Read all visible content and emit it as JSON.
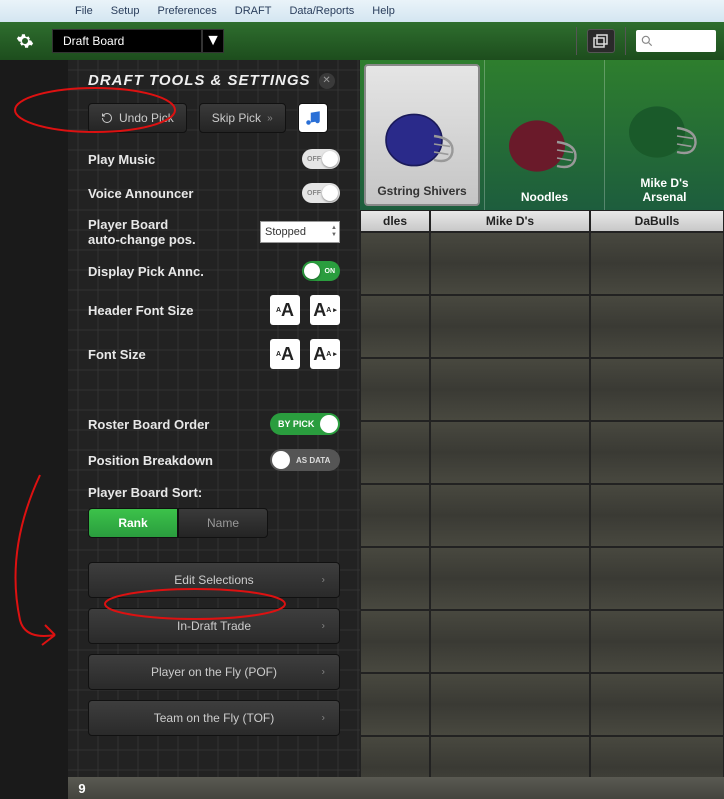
{
  "menu": {
    "file": "File",
    "setup": "Setup",
    "preferences": "Preferences",
    "draft": "DRAFT",
    "data_reports": "Data/Reports",
    "help": "Help"
  },
  "toolbar": {
    "draft_board": "Draft Board"
  },
  "panel": {
    "title": "DRAFT TOOLS & SETTINGS",
    "undo_pick": "Undo Pick",
    "skip_pick": "Skip Pick",
    "play_music": "Play Music",
    "voice_announcer": "Voice Announcer",
    "player_board_auto": "Player Board\nauto-change pos.",
    "player_board_auto_l1": "Player Board",
    "player_board_auto_l2": "auto-change pos.",
    "auto_change_value": "Stopped",
    "display_pick_annc": "Display Pick Annc.",
    "header_font_size": "Header Font Size",
    "font_size": "Font Size",
    "roster_board_order": "Roster Board Order",
    "by_pick": "BY PICK",
    "position_breakdown": "Position Breakdown",
    "as_data": "AS DATA",
    "player_board_sort": "Player Board Sort:",
    "rank": "Rank",
    "name": "Name",
    "off": "OFF",
    "on": "ON",
    "edit_selections": "Edit Selections",
    "in_draft_trade": "In-Draft Trade",
    "pof": "Player on the Fly (POF)",
    "tof": "Team on the Fly (TOF)"
  },
  "teams": {
    "t1": "Gstring Shivers",
    "t2": "Noodles",
    "t3": "Mike D's\nArsenal",
    "t3_l1": "Mike D's",
    "t3_l2": "Arsenal"
  },
  "grid": {
    "col1": "dles",
    "col2": "Mike D's",
    "col3": "DaBulls"
  },
  "footer": {
    "round": "9"
  }
}
